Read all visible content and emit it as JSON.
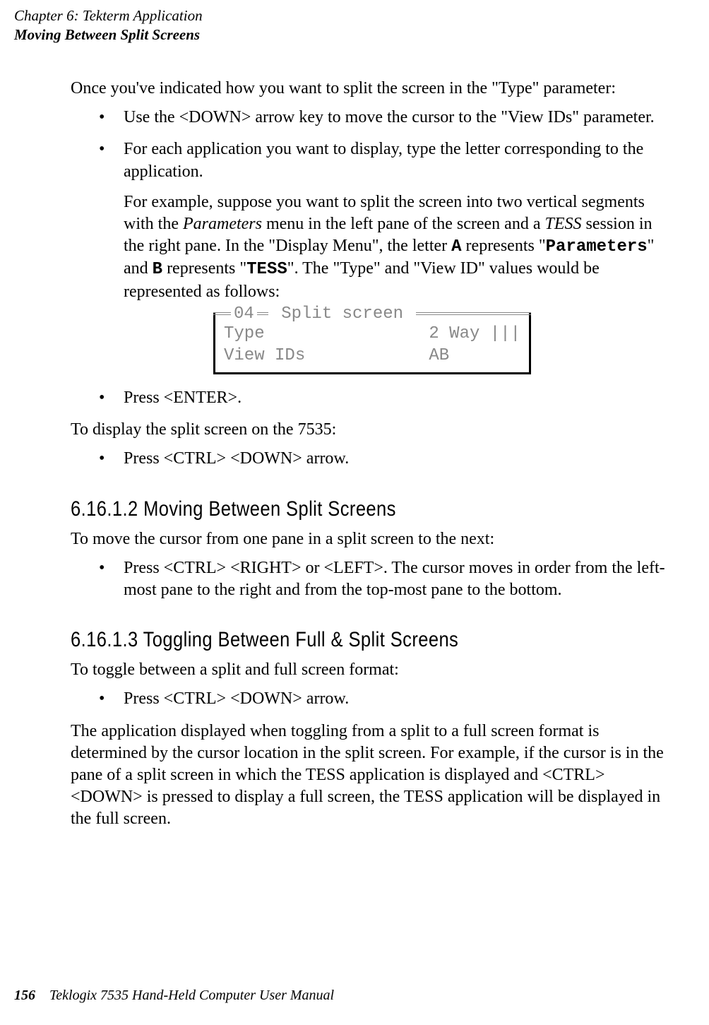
{
  "header": {
    "chapter": "Chapter 6: Tekterm Application",
    "section": "Moving Between Split Screens"
  },
  "intro": "Once you've indicated how you want to split the screen in the \"Type\" parameter:",
  "bullets1": {
    "item1": "Use the <DOWN> arrow key to move the cursor to the \"View IDs\" parameter.",
    "item2": "For each application you want to display, type the letter corresponding to the application.",
    "item2_sub_pre": "For example, suppose you want to split the screen into two vertical segments with the ",
    "item2_sub_italic1": "Parameters",
    "item2_sub_mid1": " menu in the left pane of the screen and a ",
    "item2_sub_italic2": "TESS",
    "item2_sub_mid2": " session in the right pane. In the \"Display Menu\", the letter ",
    "item2_sub_mono1": "A",
    "item2_sub_mid3": " represents \"",
    "item2_sub_mono2": "Parameters",
    "item2_sub_mid4": "\" and ",
    "item2_sub_mono3": "B",
    "item2_sub_mid5": " represents \"",
    "item2_sub_mono4": "TESS",
    "item2_sub_mid6": "\". The \"Type\" and \"View ID\" values would be represented as follows:"
  },
  "terminal": {
    "legend_num": "04",
    "legend_text": " Split screen ",
    "row1_label": "Type",
    "row1_value": "2 Way |||",
    "row2_label": "View IDs",
    "row2_value": "AB       "
  },
  "bullets2": {
    "item1": "Press <ENTER>."
  },
  "para2": "To display the split screen on the 7535:",
  "bullets3": {
    "item1": "Press <CTRL> <DOWN> arrow."
  },
  "section1": {
    "heading": "6.16.1.2  Moving Between Split Screens",
    "intro": "To move the cursor from one pane in a split screen to the next:",
    "bullet1": "Press <CTRL> <RIGHT> or <LEFT>. The cursor moves in order from the left-most pane to the right and from the top-most pane to the bottom."
  },
  "section2": {
    "heading": "6.16.1.3  Toggling Between Full & Split Screens",
    "intro": "To toggle between a split and full screen format:",
    "bullet1": "Press <CTRL> <DOWN> arrow.",
    "para": "The application displayed when toggling from a split to a full screen format is determined by the cursor location in the split screen. For example, if the cursor is in the pane of a split screen in which the TESS application is displayed and <CTRL> <DOWN> is pressed to display a full screen, the TESS application will be displayed in the full screen."
  },
  "footer": {
    "page": "156",
    "title": "Teklogix 7535 Hand-Held Computer User Manual"
  }
}
